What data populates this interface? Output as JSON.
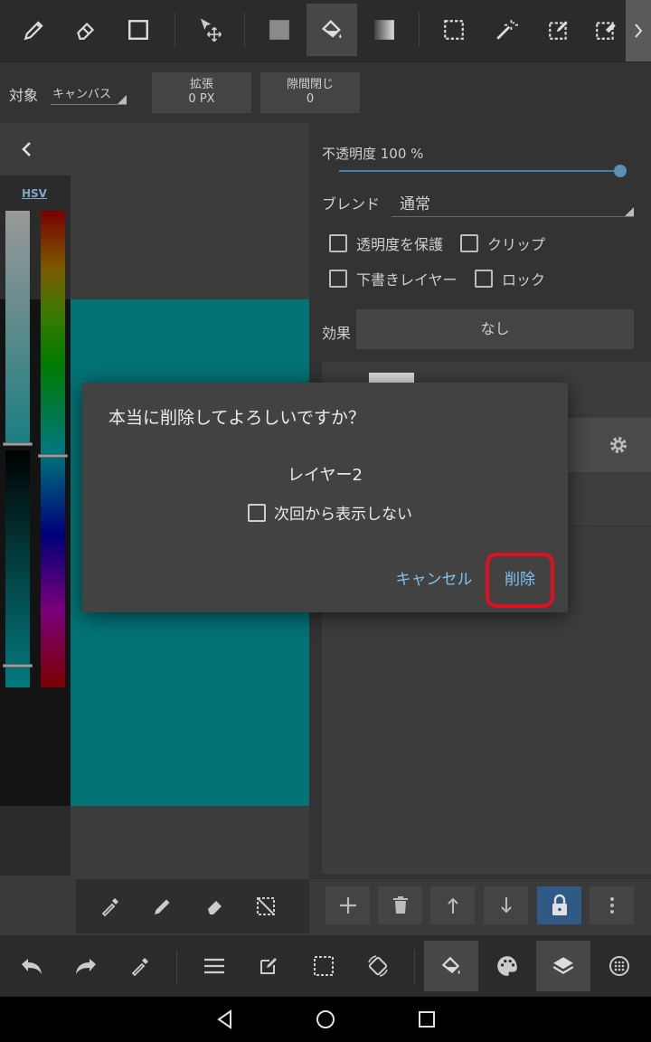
{
  "toolbar": {
    "tools": [
      "pen",
      "eraser",
      "shape",
      "move",
      "fill-color",
      "bucket",
      "gradient",
      "select-rect",
      "magic-wand",
      "select-pen",
      "select-eraser"
    ]
  },
  "options": {
    "target_label": "対象",
    "target_value": "キャンバス",
    "expand_label": "拡張",
    "expand_value": "0 PX",
    "gap_label": "隙間閉じ",
    "gap_value": "0"
  },
  "color_panel": {
    "mode_tab": "HSV"
  },
  "layer_panel": {
    "opacity_label": "不透明度 100 %",
    "opacity_value": 100,
    "blend_label": "ブレンド",
    "blend_value": "通常",
    "checkboxes": {
      "protect_alpha": "透明度を保護",
      "clip": "クリップ",
      "draft": "下書きレイヤー",
      "lock": "ロック"
    },
    "effect_label": "効果",
    "effect_value": "なし"
  },
  "dialog": {
    "title": "本当に削除してよろしいですか？",
    "layer_name": "レイヤー2",
    "dont_show_again": "次回から表示しない",
    "cancel_label": "キャンセル",
    "delete_label": "削除"
  },
  "colors": {
    "canvas": "#037376",
    "accent": "#7ec4f0",
    "highlight_border": "#e01020",
    "active_lock": "#2f5a86"
  }
}
